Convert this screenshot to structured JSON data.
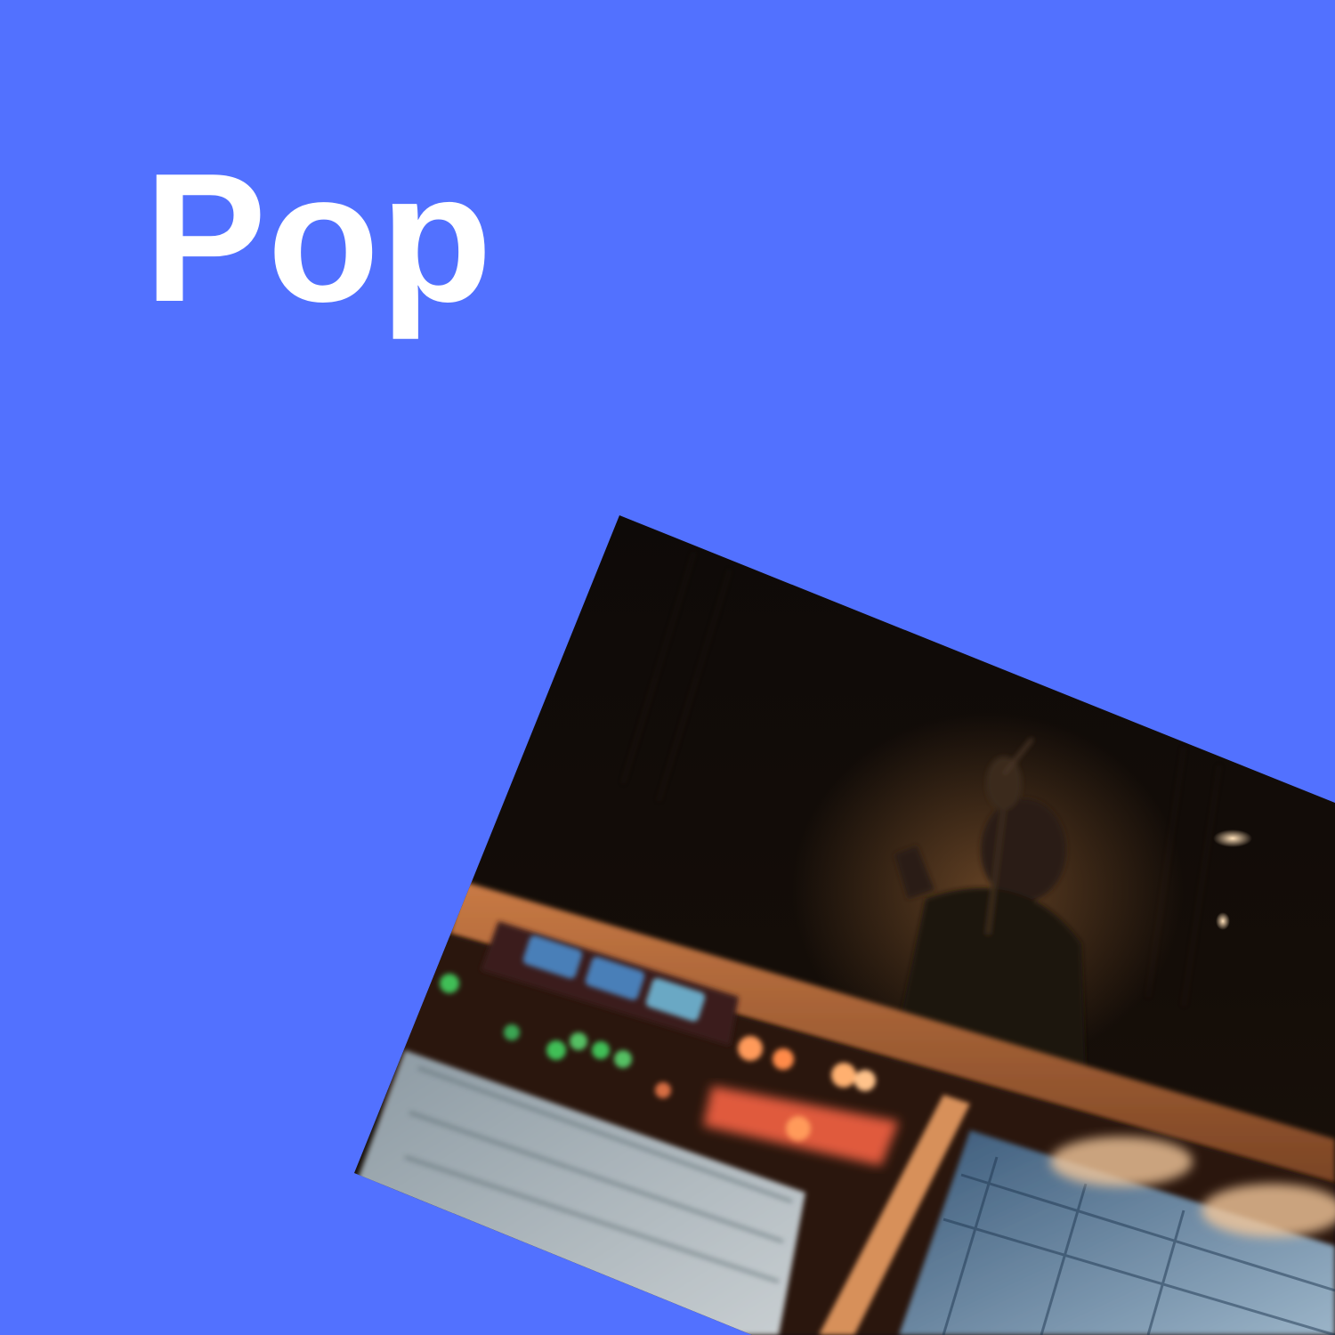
{
  "card": {
    "title": "Pop",
    "background_color": "#5271ff",
    "title_color": "#ffffff"
  },
  "photo": {
    "icon": "recording-studio-photo"
  }
}
